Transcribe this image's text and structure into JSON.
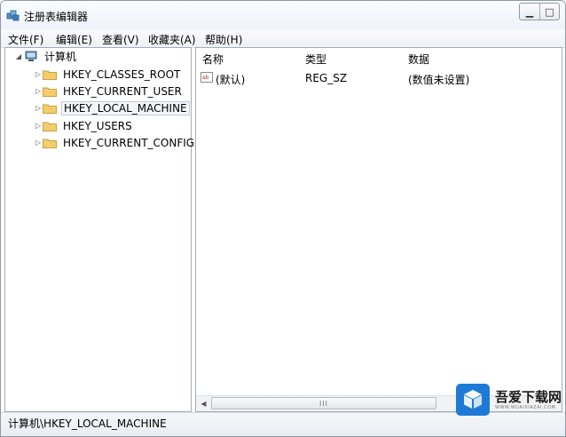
{
  "window": {
    "title": "注册表编辑器",
    "controls": [
      "minimize-icon",
      "maximize-icon"
    ]
  },
  "menu": [
    {
      "label": "文件(F)"
    },
    {
      "label": "编辑(E)"
    },
    {
      "label": "查看(V)"
    },
    {
      "label": "收藏夹(A)"
    },
    {
      "label": "帮助(H)"
    }
  ],
  "tree": {
    "root": "计算机",
    "items": [
      {
        "label": "HKEY_CLASSES_ROOT"
      },
      {
        "label": "HKEY_CURRENT_USER"
      },
      {
        "label": "HKEY_LOCAL_MACHINE",
        "selected": true
      },
      {
        "label": "HKEY_USERS"
      },
      {
        "label": "HKEY_CURRENT_CONFIG"
      }
    ]
  },
  "list": {
    "columns": {
      "name": "名称",
      "type": "类型",
      "data": "数据"
    },
    "rows": [
      {
        "name": "(默认)",
        "type": "REG_SZ",
        "data": "(数值未设置)"
      }
    ],
    "scroll_grip": "III"
  },
  "status": {
    "path": "计算机\\HKEY_LOCAL_MACHINE"
  },
  "watermark": {
    "name": "吾爱下载网",
    "url": "WWW.WUAIXIAZAI.COM",
    "brand_color": "#1f7ad6"
  }
}
